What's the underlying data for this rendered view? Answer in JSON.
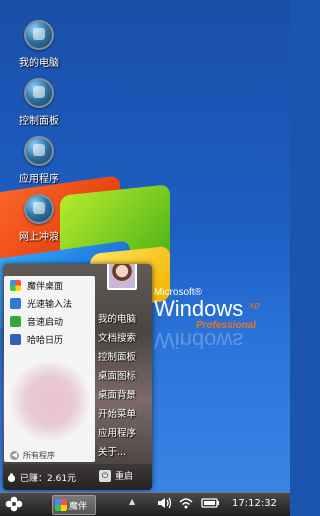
{
  "desktop": {
    "icons": [
      {
        "label": "我的电脑",
        "icon": "my-computer-icon"
      },
      {
        "label": "控制面板",
        "icon": "control-panel-icon"
      },
      {
        "label": "应用程序",
        "icon": "applications-icon"
      },
      {
        "label": "网上冲浪",
        "icon": "internet-browse-icon"
      }
    ],
    "logo": {
      "brand": "Microsoft®",
      "product": "Windows",
      "version": "xp",
      "edition": "Professional"
    }
  },
  "start_menu": {
    "apps": [
      {
        "label": "魔伴桌面",
        "icon": "mobanzhuomian-icon",
        "color": "#f5a623"
      },
      {
        "label": "光速输入法",
        "icon": "input-method-icon",
        "color": "#2e7bd6"
      },
      {
        "label": "音速启动",
        "icon": "quick-launch-icon",
        "color": "#37a63b"
      },
      {
        "label": "哈哈日历",
        "icon": "calendar-icon",
        "color": "#2f5fb8"
      }
    ],
    "all_programs": "所有程序",
    "right_items": [
      "我的电脑",
      "文档搜索",
      "控制面板",
      "桌面图标",
      "桌面背景",
      "开始菜单",
      "应用程序",
      "关于..."
    ],
    "earnings": "已赚：2.61元",
    "shutdown": "重启"
  },
  "taskbar": {
    "task_label": "魔伴",
    "tray_arrow": "▲",
    "clock": "17:12:32"
  }
}
